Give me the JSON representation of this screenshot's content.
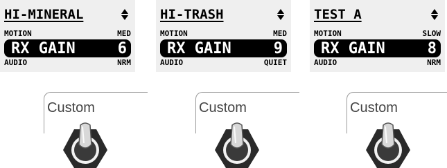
{
  "displays": [
    {
      "title": "HI-MINERAL",
      "motion_label": "MOTION",
      "motion_value": "MED",
      "gain_label": "RX GAIN",
      "gain_value": "6",
      "audio_label": "AUDIO",
      "audio_value": "NRM"
    },
    {
      "title": "HI-TRASH",
      "motion_label": "MOTION",
      "motion_value": "MED",
      "gain_label": "RX GAIN",
      "gain_value": "9",
      "audio_label": "AUDIO",
      "audio_value": "QUIET"
    },
    {
      "title": "TEST A",
      "motion_label": "MOTION",
      "motion_value": "SLOW",
      "gain_label": "RX GAIN",
      "gain_value": "8",
      "audio_label": "AUDIO",
      "audio_value": "NRM"
    }
  ],
  "switches": [
    {
      "label": "Custom",
      "icon": "toggle-switch-icon"
    },
    {
      "label": "Custom",
      "icon": "toggle-switch-icon"
    },
    {
      "label": "Custom",
      "icon": "toggle-switch-icon"
    }
  ]
}
